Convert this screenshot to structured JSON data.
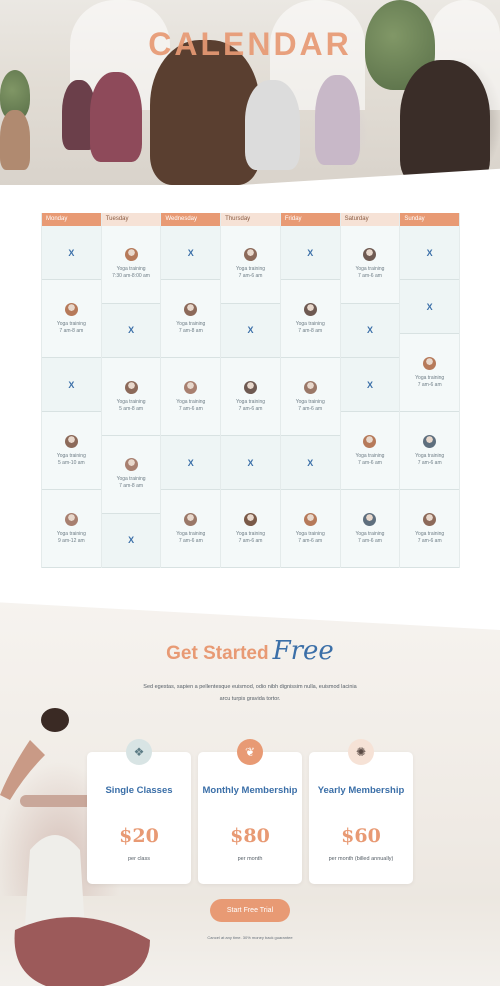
{
  "hero": {
    "title": "CALENDAR"
  },
  "colors": {
    "accent": "#e89a74",
    "blue": "#3b6fa8",
    "slot_bg": "#eef5f5"
  },
  "calendar": {
    "days": [
      {
        "name": "Monday",
        "style": "orange",
        "slots": [
          {
            "type": "x",
            "label": "X"
          },
          {
            "type": "class",
            "title": "Yoga training",
            "time": "7 am-8 am"
          },
          {
            "type": "x",
            "label": "X"
          },
          {
            "type": "class",
            "title": "Yoga training",
            "time": "5 am-10 am"
          },
          {
            "type": "class",
            "title": "Yoga training",
            "time": "9 am-12 am"
          }
        ]
      },
      {
        "name": "Tuesday",
        "style": "light",
        "slots": [
          {
            "type": "class",
            "title": "Yoga training",
            "time": "7:30 am-8:00 am"
          },
          {
            "type": "x",
            "label": "X"
          },
          {
            "type": "class",
            "title": "Yoga training",
            "time": "5 am-8 am"
          },
          {
            "type": "class",
            "title": "Yoga training",
            "time": "7 am-8 am"
          },
          {
            "type": "x",
            "label": "X"
          }
        ]
      },
      {
        "name": "Wednesday",
        "style": "orange",
        "slots": [
          {
            "type": "x",
            "label": "X"
          },
          {
            "type": "class",
            "title": "Yoga training",
            "time": "7 am-8 am"
          },
          {
            "type": "class",
            "title": "Yoga training",
            "time": "7 am-6 am"
          },
          {
            "type": "x",
            "label": "X"
          },
          {
            "type": "class",
            "title": "Yoga training",
            "time": "7 am-6 am"
          }
        ]
      },
      {
        "name": "Thursday",
        "style": "light",
        "slots": [
          {
            "type": "class",
            "title": "Yoga training",
            "time": "7 am-6 am"
          },
          {
            "type": "x",
            "label": "X"
          },
          {
            "type": "class",
            "title": "Yoga training",
            "time": "7 am-6 am"
          },
          {
            "type": "x",
            "label": "X"
          },
          {
            "type": "class",
            "title": "Yoga training",
            "time": "7 am-6 am"
          }
        ]
      },
      {
        "name": "Friday",
        "style": "orange",
        "slots": [
          {
            "type": "x",
            "label": "X"
          },
          {
            "type": "class",
            "title": "Yoga training",
            "time": "7 am-8 am"
          },
          {
            "type": "class",
            "title": "Yoga training",
            "time": "7 am-6 am"
          },
          {
            "type": "x",
            "label": "X"
          },
          {
            "type": "class",
            "title": "Yoga training",
            "time": "7 am-6 am"
          }
        ]
      },
      {
        "name": "Saturday",
        "style": "light",
        "slots": [
          {
            "type": "class",
            "title": "Yoga training",
            "time": "7 am-6 am"
          },
          {
            "type": "x",
            "label": "X"
          },
          {
            "type": "x",
            "label": "X"
          },
          {
            "type": "class",
            "title": "Yoga training",
            "time": "7 am-6 am"
          },
          {
            "type": "class",
            "title": "Yoga training",
            "time": "7 am-6 am"
          }
        ]
      },
      {
        "name": "Sunday",
        "style": "orange",
        "slots": [
          {
            "type": "x",
            "label": "X"
          },
          {
            "type": "x",
            "label": "X"
          },
          {
            "type": "class",
            "title": "Yoga training",
            "time": "7 am-6 am"
          },
          {
            "type": "class",
            "title": "Yoga training",
            "time": "7 am-6 am"
          },
          {
            "type": "class",
            "title": "Yoga training",
            "time": "7 am-6 am"
          }
        ]
      }
    ]
  },
  "get_started": {
    "heading_main": "Get Started",
    "heading_script": "Free",
    "text": "Sed egestas, sapien a pellentesque euismod, odio nibh dignissim nulla, euismod lacinia arcu turpis gravida tortor.",
    "cards": [
      {
        "icon": "lotus-icon",
        "title": "Single Classes",
        "price": "$20",
        "sub": "per class"
      },
      {
        "icon": "leaf-icon",
        "title": "Monthly Membership",
        "price": "$80",
        "sub": "per month"
      },
      {
        "icon": "flower-icon",
        "title": "Yearly Membership",
        "price": "$60",
        "sub": "per month (billed annually)"
      }
    ],
    "button": "Start Free Trial",
    "fine_print": "Cancel at any time. 30% money back guarantee"
  }
}
